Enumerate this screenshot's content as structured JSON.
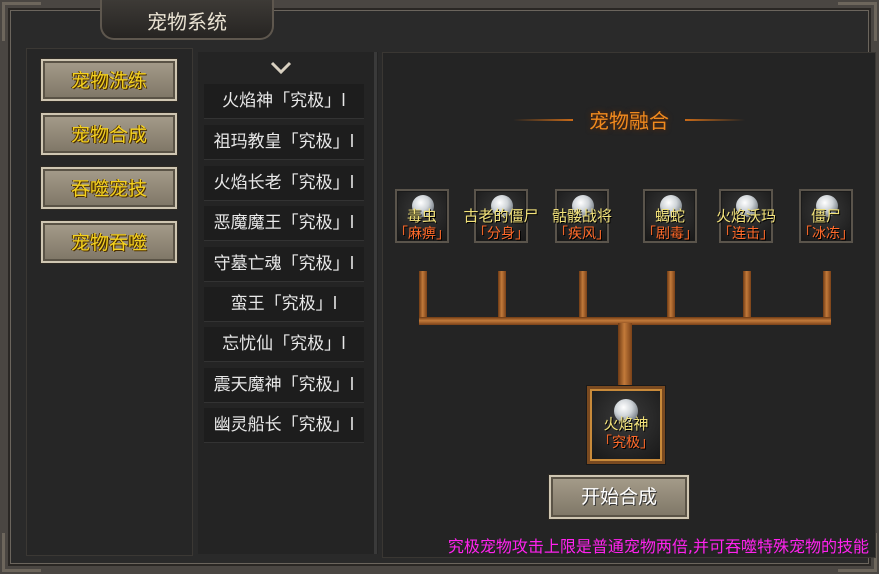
{
  "window": {
    "title": "宠物系统",
    "close_icon": "×"
  },
  "menu": [
    {
      "label": "宠物洗练"
    },
    {
      "label": "宠物合成"
    },
    {
      "label": "吞噬宠技"
    },
    {
      "label": "宠物吞噬"
    }
  ],
  "pet_list": [
    {
      "label": "火焰神「究极」l"
    },
    {
      "label": "祖玛教皇「究极」l"
    },
    {
      "label": "火焰长老「究极」l"
    },
    {
      "label": "恶魔魔王「究极」l"
    },
    {
      "label": "守墓亡魂「究极」l"
    },
    {
      "label": "蛮王「究极」l"
    },
    {
      "label": "忘忧仙「究极」l"
    },
    {
      "label": "震天魔神「究极」l"
    },
    {
      "label": "幽灵船长「究极」l"
    }
  ],
  "fusion": {
    "title": "宠物融合",
    "ingredients": [
      {
        "name": "毒虫",
        "skill": "「麻痹」"
      },
      {
        "name": "古老的僵尸",
        "skill": "「分身」"
      },
      {
        "name": "骷髅战将",
        "skill": "「疾风」"
      },
      {
        "name": "蝎蛇",
        "skill": "「剧毒」"
      },
      {
        "name": "火焰沃玛",
        "skill": "「连击」"
      },
      {
        "name": "僵尸",
        "skill": "「冰冻」"
      }
    ],
    "result": {
      "name": "火焰神",
      "skill": "「究极」"
    },
    "start_label": "开始合成",
    "note": "究极宠物攻击上限是普通宠物两倍,并可吞噬特殊宠物的技能"
  },
  "colors": {
    "gold": "#f5d21f",
    "orange": "#f08a1e",
    "skill": "#ff6a2a",
    "note": "#ff22ee"
  }
}
